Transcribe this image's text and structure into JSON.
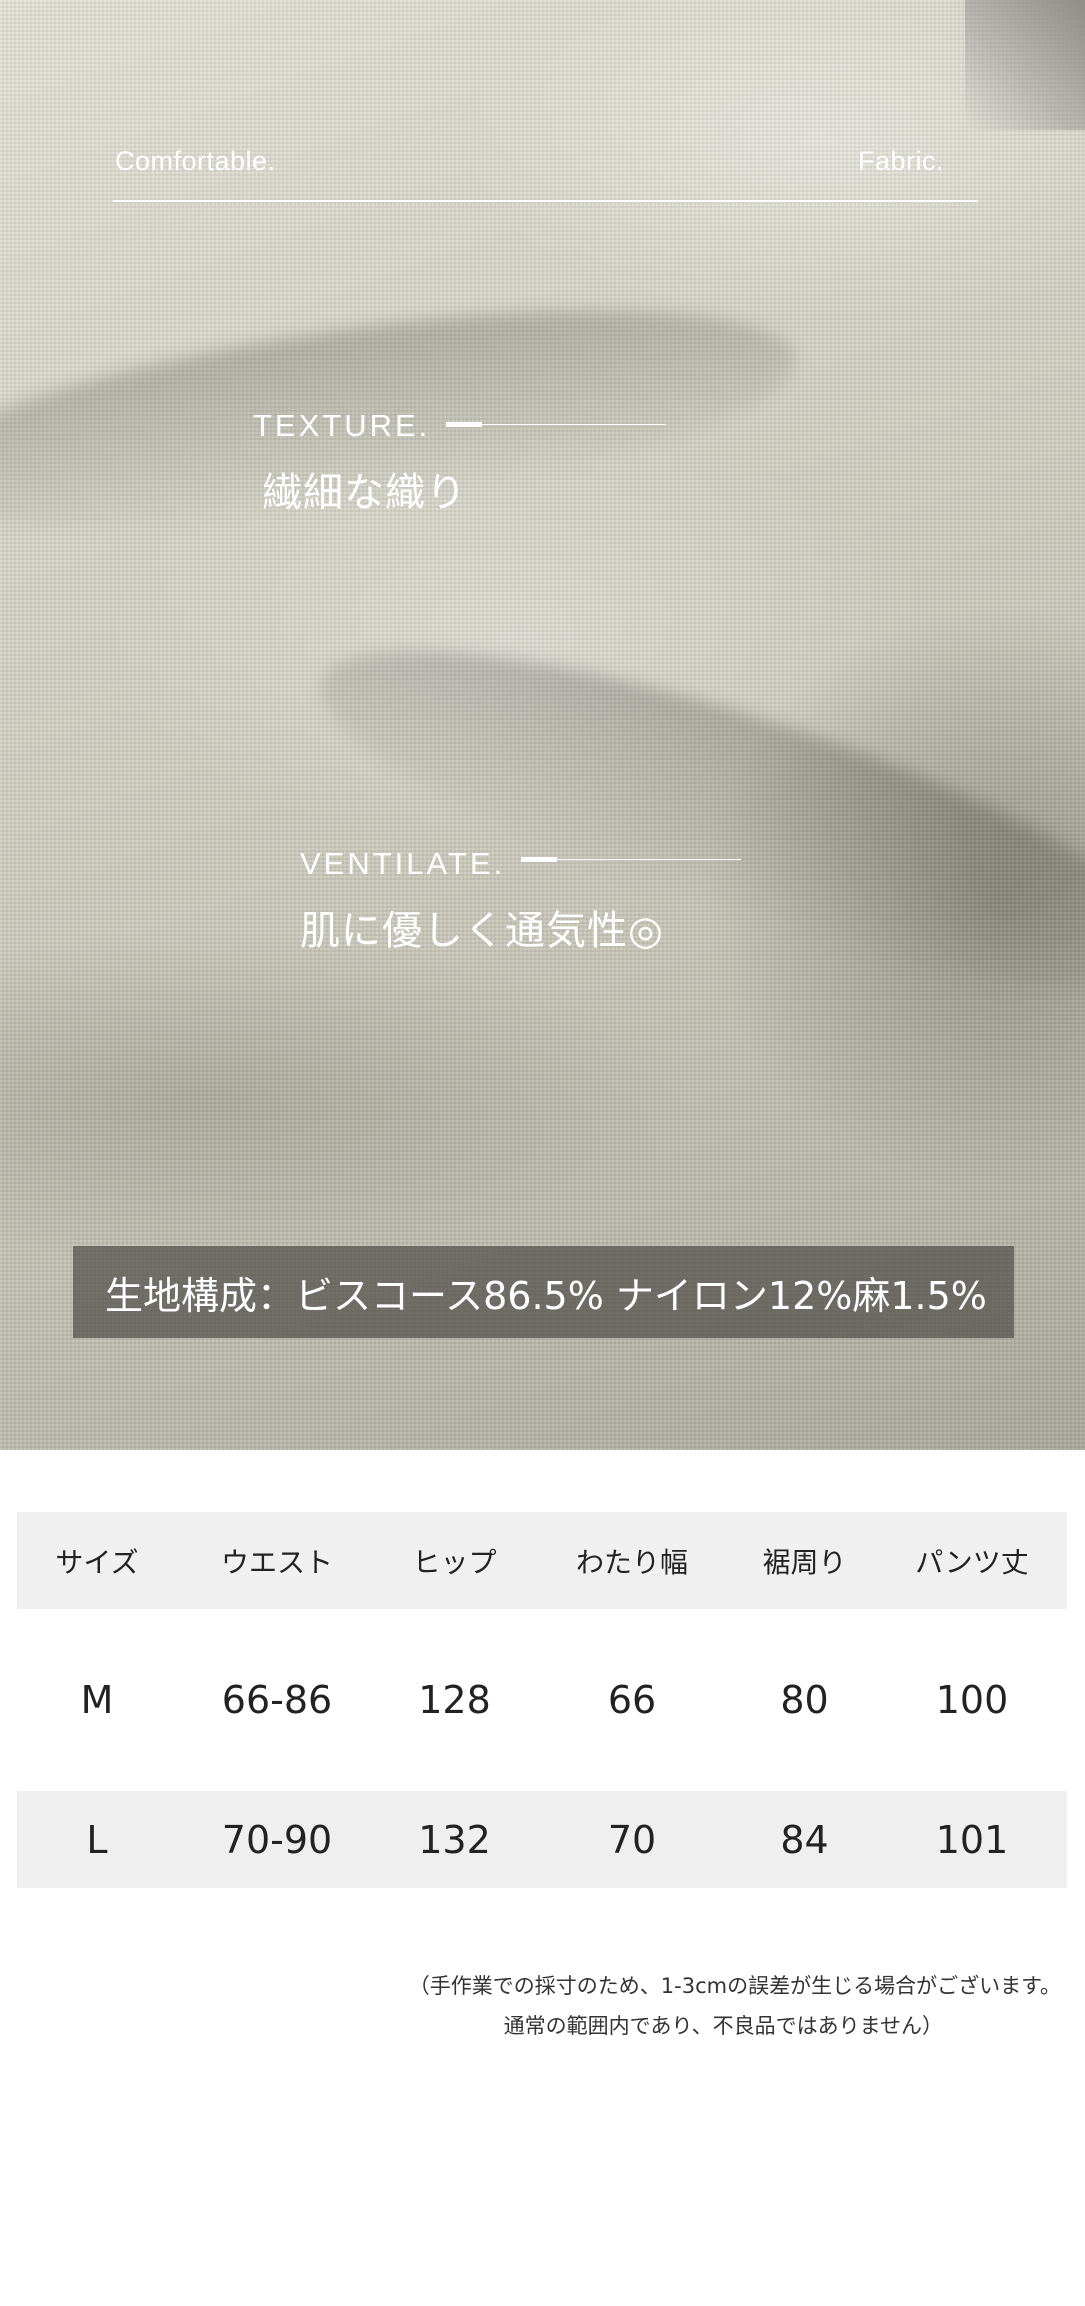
{
  "hero": {
    "top_left": "Comfortable.",
    "top_right": "Fabric.",
    "texture_en": "TEXTURE.",
    "texture_jp": "繊細な織り",
    "ventilate_en": "VENTILATE.",
    "ventilate_jp": "肌に優しく通気性◎",
    "composition": "生地構成：ビスコース86.5% ナイロン12%麻1.5%"
  },
  "size_table": {
    "headers": [
      "サイズ",
      "ウエスト",
      "ヒップ",
      "わたり幅",
      "裾周り",
      "パンツ丈"
    ],
    "rows": [
      [
        "M",
        "66-86",
        "128",
        "66",
        "80",
        "100"
      ],
      [
        "L",
        "70-90",
        "132",
        "70",
        "84",
        "101"
      ]
    ]
  },
  "note": {
    "line1": "（手作業での採寸のため、1-3cmの誤差が生じる場合がございます。",
    "line2": "通常の範囲内であり、不良品ではありません）"
  }
}
